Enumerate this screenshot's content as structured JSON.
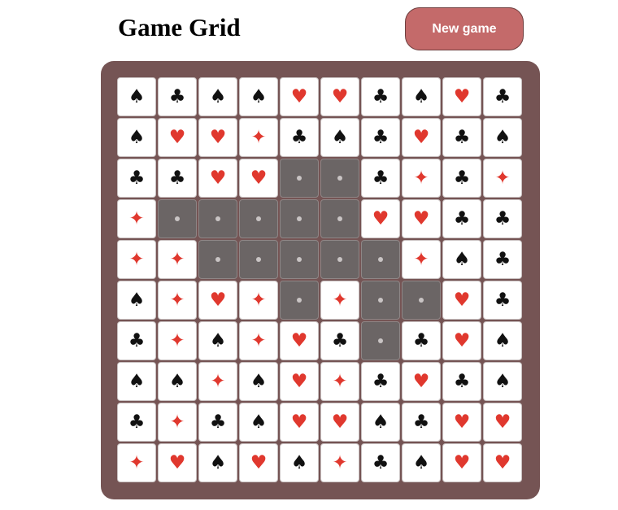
{
  "header": {
    "title": "Game Grid",
    "new_game_label": "New game"
  },
  "colors": {
    "board": "#755454",
    "button": "#c46a6a",
    "red_suit": "#e0382e",
    "black_suit": "#111111",
    "cleared_cell": "#6b6565"
  },
  "suit_glyphs": {
    "S": "♠",
    "C": "♣",
    "H": "♥",
    "D": "✦"
  },
  "grid": [
    [
      "S",
      "C",
      "S",
      "S",
      "H",
      "H",
      "C",
      "S",
      "H",
      "C"
    ],
    [
      "S",
      "H",
      "H",
      "D",
      "C",
      "S",
      "C",
      "H",
      "C",
      "S"
    ],
    [
      "C",
      "C",
      "H",
      "H",
      "X",
      "X",
      "C",
      "D",
      "C",
      "D"
    ],
    [
      "D",
      "X",
      "X",
      "X",
      "X",
      "X",
      "H",
      "H",
      "C",
      "C"
    ],
    [
      "D",
      "D",
      "X",
      "X",
      "X",
      "X",
      "X",
      "D",
      "S",
      "C"
    ],
    [
      "S",
      "D",
      "H",
      "D",
      "X",
      "D",
      "X",
      "X",
      "H",
      "C"
    ],
    [
      "C",
      "D",
      "S",
      "D",
      "H",
      "C",
      "X",
      "C",
      "H",
      "S"
    ],
    [
      "S",
      "S",
      "D",
      "S",
      "H",
      "D",
      "C",
      "H",
      "C",
      "S"
    ],
    [
      "C",
      "D",
      "C",
      "S",
      "H",
      "H",
      "S",
      "C",
      "H",
      "H"
    ],
    [
      "D",
      "H",
      "S",
      "H",
      "S",
      "D",
      "C",
      "S",
      "H",
      "H"
    ]
  ]
}
